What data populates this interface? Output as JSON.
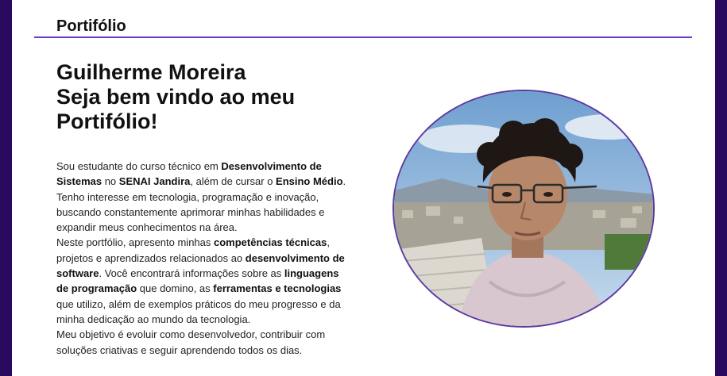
{
  "header": {
    "title": "Portifólio"
  },
  "hero": {
    "name": "Guilherme Moreira",
    "line2": "Seja bem vindo ao meu",
    "line3": "Portifólio!"
  },
  "bio": [
    {
      "t": "Sou estudante do curso técnico em ",
      "b": false
    },
    {
      "t": "Desenvolvimento de Sistemas",
      "b": true
    },
    {
      "t": " no ",
      "b": false
    },
    {
      "t": "SENAI Jandira",
      "b": true
    },
    {
      "t": ", além de cursar o ",
      "b": false
    },
    {
      "t": "Ensino Médio",
      "b": true
    },
    {
      "t": ". Tenho interesse em tecnologia, programação e inovação, buscando constantemente aprimorar minhas habilidades e expandir meus conhecimentos na área.",
      "b": false
    },
    {
      "t": "\n",
      "b": false
    },
    {
      "t": "Neste portfólio, apresento minhas ",
      "b": false
    },
    {
      "t": "competências técnicas",
      "b": true
    },
    {
      "t": ", projetos e aprendizados relacionados ao ",
      "b": false
    },
    {
      "t": "desenvolvimento de software",
      "b": true
    },
    {
      "t": ". Você encontrará informações sobre as ",
      "b": false
    },
    {
      "t": "linguagens de programação",
      "b": true
    },
    {
      "t": " que domino, as ",
      "b": false
    },
    {
      "t": "ferramentas e tecnologias",
      "b": true
    },
    {
      "t": " que utilizo, além de exemplos práticos do meu progresso e da minha dedicação ao mundo da tecnologia.",
      "b": false
    },
    {
      "t": "\n",
      "b": false
    },
    {
      "t": "Meu objetivo é evoluir como desenvolvedor, contribuir com soluções criativas e seguir aprendendo todos os dias.",
      "b": false
    }
  ],
  "colors": {
    "frame": "#2a0a5e",
    "accent": "#6a3cc8"
  }
}
